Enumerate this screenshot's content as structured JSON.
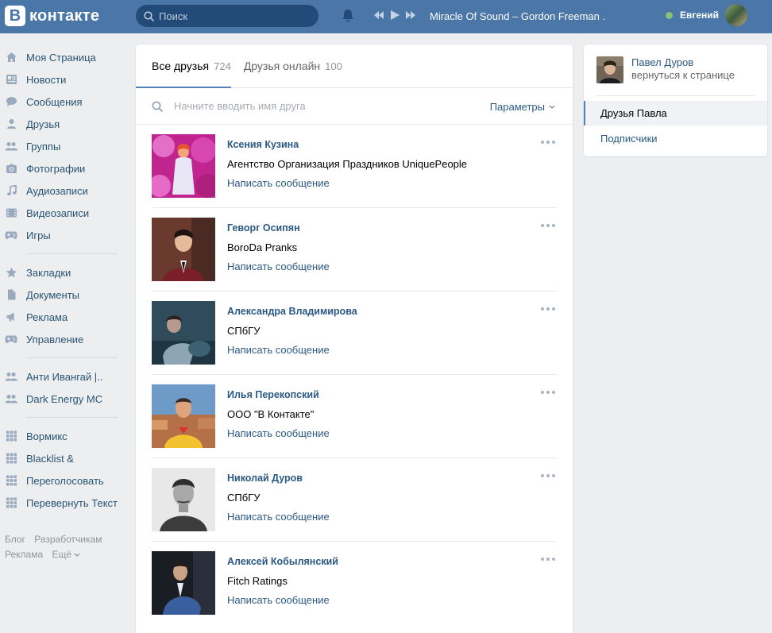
{
  "header": {
    "logo_letter": "В",
    "logo_text": "контакте",
    "search_placeholder": "Поиск",
    "now_playing": "Miracle Of Sound – Gordon Freeman ...",
    "user_name": "Евгений"
  },
  "leftnav": {
    "group1": [
      {
        "label": "Моя Страница",
        "icon": "home-icon"
      },
      {
        "label": "Новости",
        "icon": "news-icon"
      },
      {
        "label": "Сообщения",
        "icon": "messages-icon"
      },
      {
        "label": "Друзья",
        "icon": "friends-icon"
      },
      {
        "label": "Группы",
        "icon": "groups-icon"
      },
      {
        "label": "Фотографии",
        "icon": "photos-icon"
      },
      {
        "label": "Аудиозаписи",
        "icon": "music-icon"
      },
      {
        "label": "Видеозаписи",
        "icon": "video-icon"
      },
      {
        "label": "Игры",
        "icon": "gamepad-icon"
      }
    ],
    "group2": [
      {
        "label": "Закладки",
        "icon": "star-icon"
      },
      {
        "label": "Документы",
        "icon": "document-icon"
      },
      {
        "label": "Реклама",
        "icon": "megaphone-icon"
      },
      {
        "label": "Управление",
        "icon": "gamepad-icon"
      }
    ],
    "group3": [
      {
        "label": "Анти Ивангай |..",
        "icon": "groups-icon"
      },
      {
        "label": "Dark Energy MC",
        "icon": "groups-icon"
      }
    ],
    "group4": [
      {
        "label": "Вормикс",
        "icon": "apps-icon"
      },
      {
        "label": "Blacklist &",
        "icon": "apps-icon"
      },
      {
        "label": "Переголосовать",
        "icon": "apps-icon"
      },
      {
        "label": "Перевернуть Текст",
        "icon": "apps-icon"
      }
    ],
    "footer": {
      "blog": "Блог",
      "developers": "Разработчикам",
      "ads": "Реклама",
      "more": "Ещё"
    }
  },
  "main": {
    "tabs": [
      {
        "label": "Все друзья",
        "count": "724"
      },
      {
        "label": "Друзья онлайн",
        "count": "100"
      }
    ],
    "filter_placeholder": "Начните вводить имя друга",
    "params_label": "Параметры",
    "friends": [
      {
        "name": "Ксения Кузина",
        "sub": "Агентство Организация Праздников UniquePeople",
        "msg": "Написать сообщение"
      },
      {
        "name": "Геворг Осипян",
        "sub": "BoroDa Pranks",
        "msg": "Написать сообщение"
      },
      {
        "name": "Александра Владимирова",
        "sub": "СПбГУ",
        "msg": "Написать сообщение"
      },
      {
        "name": "Илья Перекопский",
        "sub": "ООО \"В Контакте\"",
        "msg": "Написать сообщение"
      },
      {
        "name": "Николай Дуров",
        "sub": "СПбГУ",
        "msg": "Написать сообщение"
      },
      {
        "name": "Алексей Кобылянский",
        "sub": "Fitch Ratings",
        "msg": "Написать сообщение"
      }
    ]
  },
  "right": {
    "user_name": "Павел Дуров",
    "back_label": "вернуться к странице",
    "items": [
      {
        "label": "Друзья Павла"
      },
      {
        "label": "Подписчики"
      }
    ]
  },
  "colors": {
    "header": "#4a76a8",
    "link": "#2a5885",
    "online": "#8ac176"
  }
}
